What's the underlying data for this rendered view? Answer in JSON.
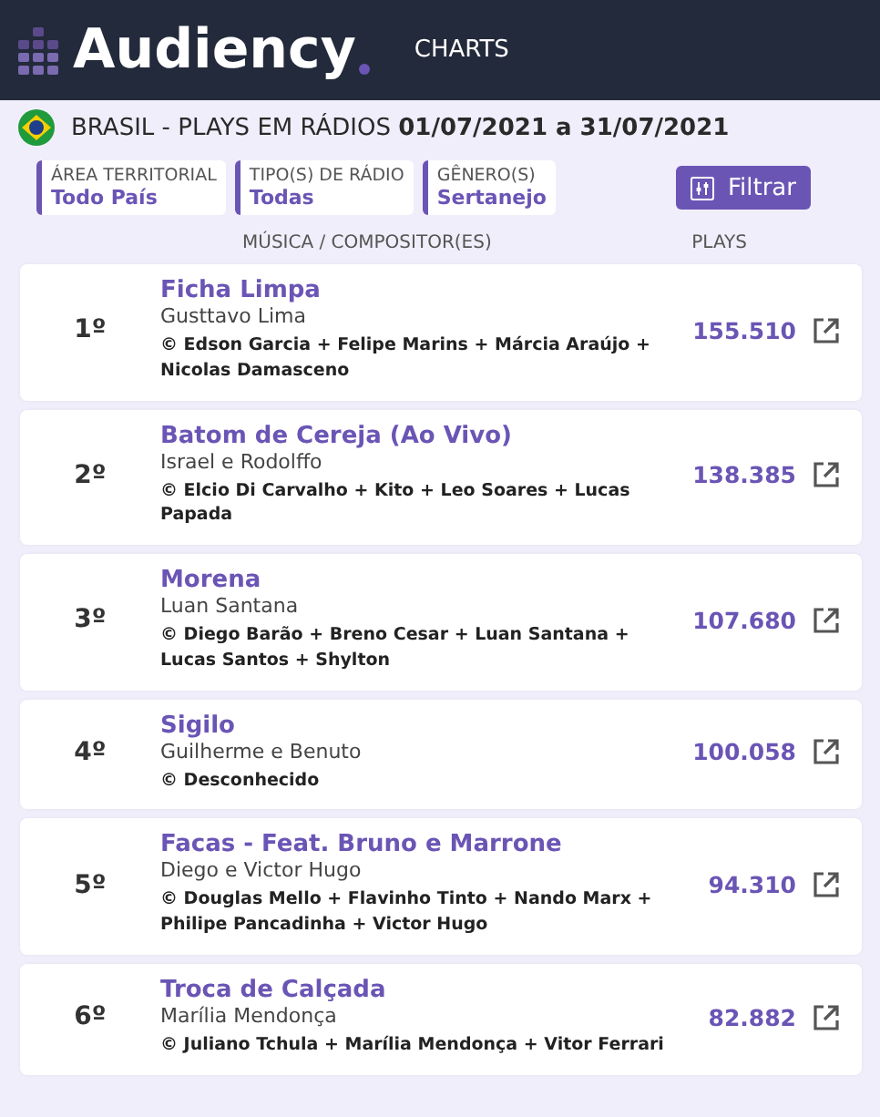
{
  "header": {
    "logo": "Audiency",
    "nav": "CHARTS"
  },
  "title": "BRASIL - PLAYS EM RÁDIOS **01/07/2021 a 31/07/2021**",
  "filters": [
    {
      "label": "ÁREA TERRITORIAL",
      "value": "Todo País"
    },
    {
      "label": "TIPO(S) DE RÁDIO",
      "value": "Todas"
    },
    {
      "label": "GÊNERO(S)",
      "value": "Sertanejo"
    }
  ],
  "filter_button": "Filtrar",
  "columns": [
    "MÚSICA / COMPOSITOR(ES)",
    "PLAYS"
  ],
  "rows": [
    {
      "rank": "1º",
      "title": "Ficha Limpa",
      "artist": "Gusttavo Lima",
      "composers": "© Edson Garcia + Felipe Marins + Márcia Araújo + Nicolas Damasceno",
      "plays": "155.510"
    },
    {
      "rank": "2º",
      "title": "Batom de Cereja (Ao Vivo)",
      "artist": "Israel e Rodolffo",
      "composers": "© Elcio Di Carvalho + Kito + Leo Soares + Lucas Papada",
      "plays": "138.385"
    },
    {
      "rank": "3º",
      "title": "Morena",
      "artist": "Luan Santana",
      "composers": "© Diego Barão + Breno Cesar + Luan Santana + Lucas Santos + Shylton",
      "plays": "107.680"
    },
    {
      "rank": "4º",
      "title": "Sigilo",
      "artist": "Guilherme e Benuto",
      "composers": "© Desconhecido",
      "plays": "100.058"
    },
    {
      "rank": "5º",
      "title": "Facas - Feat. Bruno e Marrone",
      "artist": "Diego e Victor Hugo",
      "composers": "© Douglas Mello + Flavinho Tinto + Nando Marx + Philipe Pancadinha + Victor Hugo",
      "plays": "94.310"
    },
    {
      "rank": "6º",
      "title": "Troca de Calçada",
      "artist": "Marília Mendonça",
      "composers": "© Juliano Tchula + Marília Mendonça + Vitor Ferrari",
      "plays": "82.882"
    }
  ]
}
